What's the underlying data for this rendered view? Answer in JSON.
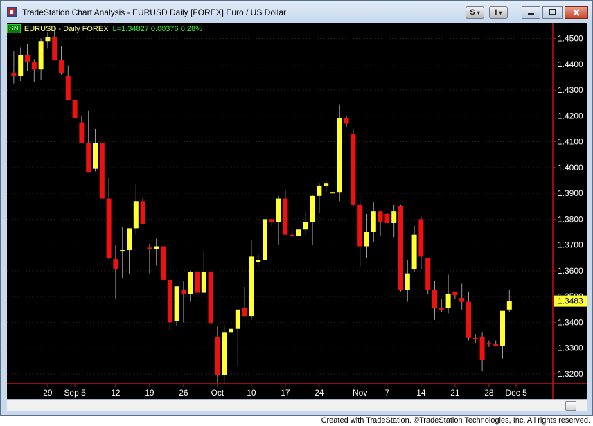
{
  "window": {
    "title": "TradeStation Chart Analysis - EURUSD Daily [FOREX] Euro / US Dollar",
    "buttons": {
      "s_label": "S",
      "i_label": "I"
    }
  },
  "symbol_line": {
    "badge": "SN",
    "name": "EURUSD - Daily  FOREX",
    "stats": "L=1.34827  0.00376  0.28%"
  },
  "price_axis": {
    "ticks": [
      "1.4500",
      "1.4400",
      "1.4300",
      "1.4200",
      "1.4100",
      "1.4000",
      "1.3900",
      "1.3800",
      "1.3700",
      "1.3600",
      "1.3500",
      "1.3400",
      "1.3300",
      "1.3200"
    ],
    "last_price_label": "1.3483"
  },
  "date_axis": {
    "labels": [
      {
        "text": "29",
        "index": 5
      },
      {
        "text": "Sep 5",
        "index": 9
      },
      {
        "text": "12",
        "index": 15
      },
      {
        "text": "19",
        "index": 20
      },
      {
        "text": "26",
        "index": 25
      },
      {
        "text": "Oct",
        "index": 30
      },
      {
        "text": "10",
        "index": 35
      },
      {
        "text": "17",
        "index": 40
      },
      {
        "text": "24",
        "index": 45
      },
      {
        "text": "Nov",
        "index": 51
      },
      {
        "text": "7",
        "index": 55
      },
      {
        "text": "14",
        "index": 60
      },
      {
        "text": "21",
        "index": 65
      },
      {
        "text": "28",
        "index": 70
      },
      {
        "text": "Dec 5",
        "index": 74
      }
    ]
  },
  "footer": {
    "text": "Created with TradeStation. ©TradeStation Technologies, Inc. All rights reserved."
  },
  "colors": {
    "up_candle": "#ffff33",
    "down_candle": "#ee1111",
    "wick": "#9a9a9a",
    "axis_line": "#cc1111",
    "background": "#000000",
    "last_price_bg": "#ffff33"
  },
  "chart_data": {
    "type": "candlestick",
    "title": "EURUSD Daily [FOREX] Euro / US Dollar",
    "ylim": [
      1.3165,
      1.4555
    ],
    "last_price": 1.34827,
    "ohlc": [
      [
        1.4365,
        1.445,
        1.4325,
        1.4355
      ],
      [
        1.4355,
        1.4465,
        1.4335,
        1.4435
      ],
      [
        1.4435,
        1.448,
        1.4375,
        1.441
      ],
      [
        1.441,
        1.442,
        1.433,
        1.438
      ],
      [
        1.438,
        1.45,
        1.434,
        1.449
      ],
      [
        1.449,
        1.4525,
        1.446,
        1.4505
      ],
      [
        1.4505,
        1.4545,
        1.4425,
        1.4415
      ],
      [
        1.4415,
        1.447,
        1.436,
        1.4365
      ],
      [
        1.4355,
        1.4395,
        1.4265,
        1.426
      ],
      [
        1.426,
        1.426,
        1.4195,
        1.419
      ],
      [
        1.4175,
        1.42,
        1.4095,
        1.4095
      ],
      [
        1.4095,
        1.422,
        1.3985,
        1.398
      ],
      [
        1.3995,
        1.415,
        1.3985,
        1.4095
      ],
      [
        1.4095,
        1.4095,
        1.389,
        1.388
      ],
      [
        1.388,
        1.396,
        1.3645,
        1.365
      ],
      [
        1.3645,
        1.37,
        1.349,
        1.3605
      ],
      [
        1.368,
        1.377,
        1.357,
        1.368
      ],
      [
        1.368,
        1.3765,
        1.359,
        1.3765
      ],
      [
        1.3765,
        1.3935,
        1.374,
        1.387
      ],
      [
        1.387,
        1.388,
        1.379,
        1.378
      ],
      [
        1.369,
        1.3705,
        1.359,
        1.3685
      ],
      [
        1.3685,
        1.3725,
        1.362,
        1.3695
      ],
      [
        1.3695,
        1.3775,
        1.3565,
        1.3565
      ],
      [
        1.3565,
        1.356,
        1.337,
        1.34
      ],
      [
        1.3405,
        1.3525,
        1.3385,
        1.354
      ],
      [
        1.3525,
        1.356,
        1.34,
        1.351
      ],
      [
        1.351,
        1.36,
        1.348,
        1.3595
      ],
      [
        1.3595,
        1.3685,
        1.351,
        1.3515
      ],
      [
        1.3515,
        1.3675,
        1.3515,
        1.3595
      ],
      [
        1.3595,
        1.359,
        1.3395,
        1.3395
      ],
      [
        1.3345,
        1.3385,
        1.3165,
        1.3195
      ],
      [
        1.3195,
        1.339,
        1.316,
        1.336
      ],
      [
        1.336,
        1.3445,
        1.327,
        1.3375
      ],
      [
        1.3375,
        1.345,
        1.323,
        1.345
      ],
      [
        1.3455,
        1.3535,
        1.342,
        1.3425
      ],
      [
        1.3425,
        1.372,
        1.341,
        1.3655
      ],
      [
        1.364,
        1.3665,
        1.362,
        1.364
      ],
      [
        1.364,
        1.383,
        1.3575,
        1.38
      ],
      [
        1.38,
        1.3805,
        1.3775,
        1.379
      ],
      [
        1.379,
        1.389,
        1.37,
        1.388
      ],
      [
        1.388,
        1.391,
        1.374,
        1.374
      ],
      [
        1.374,
        1.376,
        1.373,
        1.3735
      ],
      [
        1.3735,
        1.381,
        1.372,
        1.376
      ],
      [
        1.376,
        1.383,
        1.374,
        1.379
      ],
      [
        1.379,
        1.3895,
        1.37,
        1.389
      ],
      [
        1.389,
        1.394,
        1.3825,
        1.393
      ],
      [
        1.393,
        1.395,
        1.3905,
        1.394
      ],
      [
        1.39,
        1.391,
        1.3895,
        1.3905
      ],
      [
        1.3905,
        1.4245,
        1.387,
        1.419
      ],
      [
        1.419,
        1.42,
        1.4155,
        1.417
      ],
      [
        1.413,
        1.415,
        1.385,
        1.3855
      ],
      [
        1.3855,
        1.387,
        1.3615,
        1.3695
      ],
      [
        1.3695,
        1.382,
        1.365,
        1.375
      ],
      [
        1.375,
        1.3865,
        1.371,
        1.383
      ],
      [
        1.383,
        1.383,
        1.3735,
        1.379
      ],
      [
        1.382,
        1.3825,
        1.379,
        1.3785
      ],
      [
        1.3785,
        1.3855,
        1.373,
        1.383
      ],
      [
        1.385,
        1.3855,
        1.352,
        1.3525
      ],
      [
        1.3525,
        1.364,
        1.348,
        1.359
      ],
      [
        1.3605,
        1.3775,
        1.3595,
        1.374
      ],
      [
        1.38,
        1.381,
        1.3605,
        1.3655
      ],
      [
        1.365,
        1.365,
        1.351,
        1.3525
      ],
      [
        1.3525,
        1.356,
        1.341,
        1.3455
      ],
      [
        1.3455,
        1.349,
        1.344,
        1.345
      ],
      [
        1.3455,
        1.3585,
        1.3435,
        1.351
      ],
      [
        1.352,
        1.3515,
        1.349,
        1.3505
      ],
      [
        1.3495,
        1.355,
        1.345,
        1.348
      ],
      [
        1.348,
        1.352,
        1.333,
        1.334
      ],
      [
        1.334,
        1.3355,
        1.332,
        1.3335
      ],
      [
        1.3345,
        1.336,
        1.321,
        1.3255
      ],
      [
        1.332,
        1.333,
        1.3305,
        1.3315
      ],
      [
        1.3315,
        1.333,
        1.331,
        1.331
      ],
      [
        1.331,
        1.342,
        1.326,
        1.3445
      ],
      [
        1.345,
        1.3525,
        1.344,
        1.3483
      ]
    ]
  }
}
